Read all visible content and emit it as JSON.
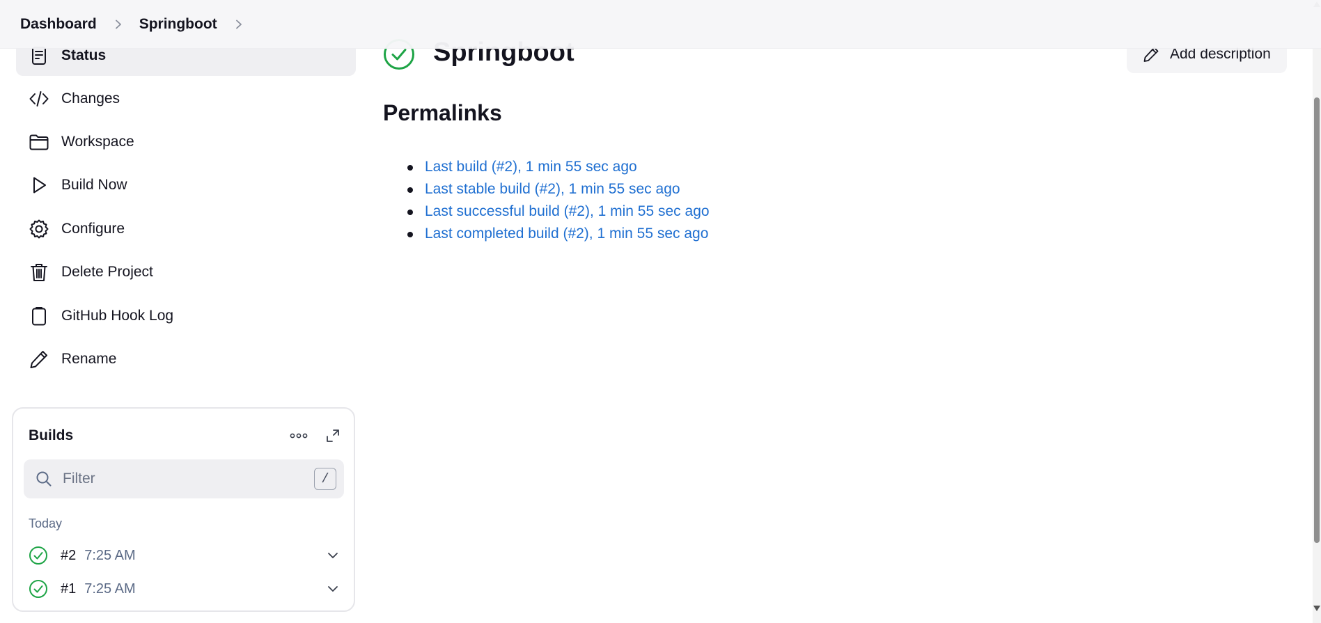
{
  "breadcrumb": {
    "items": [
      {
        "label": "Dashboard"
      },
      {
        "label": "Springboot"
      }
    ]
  },
  "sidebar": {
    "items": [
      {
        "label": "Status",
        "icon": "document-icon",
        "active": true
      },
      {
        "label": "Changes",
        "icon": "code-icon"
      },
      {
        "label": "Workspace",
        "icon": "folder-icon"
      },
      {
        "label": "Build Now",
        "icon": "play-icon"
      },
      {
        "label": "Configure",
        "icon": "gear-icon"
      },
      {
        "label": "Delete Project",
        "icon": "trash-icon"
      },
      {
        "label": "GitHub Hook Log",
        "icon": "clipboard-icon"
      },
      {
        "label": "Rename",
        "icon": "pencil-icon"
      }
    ]
  },
  "builds": {
    "title": "Builds",
    "filter_placeholder": "Filter",
    "shortcut_key": "/",
    "group_label": "Today",
    "rows": [
      {
        "number": "#2",
        "time": "7:25 AM",
        "status": "success"
      },
      {
        "number": "#1",
        "time": "7:25 AM",
        "status": "success"
      }
    ]
  },
  "main": {
    "title": "Springboot",
    "add_description_label": "Add description",
    "permalinks_heading": "Permalinks",
    "permalinks": [
      "Last build (#2), 1 min 55 sec ago",
      "Last stable build (#2), 1 min 55 sec ago",
      "Last successful build (#2), 1 min 55 sec ago",
      "Last completed build (#2), 1 min 55 sec ago"
    ]
  },
  "colors": {
    "success": "#1ea446",
    "link": "#1f6fd1",
    "text": "#14141f",
    "muted": "#5b6a86"
  }
}
